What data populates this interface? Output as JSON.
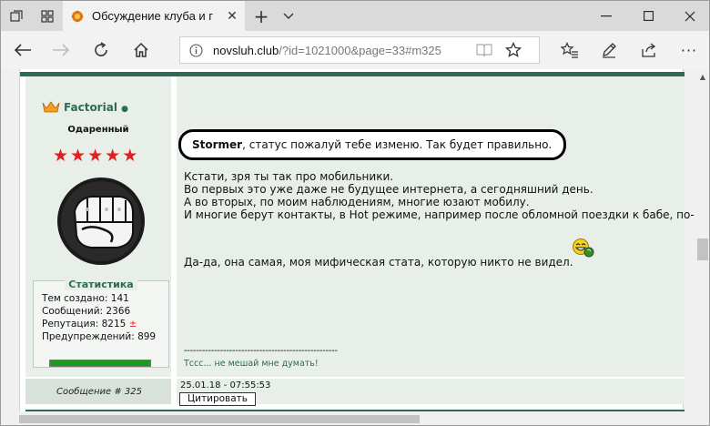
{
  "browser": {
    "tab_title": "Обсуждение клуба и г",
    "address": {
      "host": "novsluh.club",
      "path": "/?id=1021000&page=33#m325"
    }
  },
  "post": {
    "username": "Factorial",
    "online_dot": "●",
    "rank": "Одаренный",
    "star_count": 5,
    "stats": {
      "title": "Статистика",
      "created_label": "Тем создано:",
      "created": "141",
      "messages_label": "Сообщений:",
      "messages": "2366",
      "reputation_label": "Репутация:",
      "reputation": "8215",
      "reputation_mark": "±",
      "warnings_label": "Предупреждений:",
      "warnings": "899"
    },
    "callout": {
      "bold_name": "Stormer",
      "text": ", статус пожалуй тебе изменю. Так будет правильно."
    },
    "body_lines": [
      "Кстати, зря ты так про мобильники.",
      "Во первых это уже даже не будущее интернета, а сегодняшний день.",
      "А во вторых, по моим наблюдениям, многие юзают мобилу.",
      "И многие берут контакты, в Hot режиме, например после обломной поездки к бабе, по-бы"
    ],
    "body_line2": "Да-да, она самая, моя мифическая стата, которую никто не видел.",
    "signature_line": "---------------------------------------------------",
    "signature": "Тссс... не мешай мне думать!",
    "message_number_label": "Сообщение # 325",
    "date": "25.01.18 - 07:55:53",
    "quote_button": "Цитировать"
  },
  "colors": {
    "forum_green": "#2c6b58",
    "stars": "#e02020",
    "warnbar": "#1a9a1a"
  }
}
